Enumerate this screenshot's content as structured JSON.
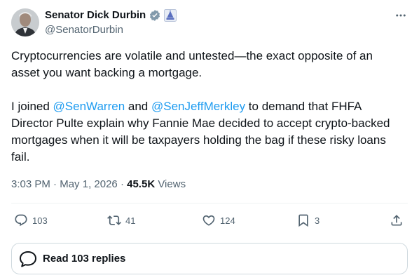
{
  "author": {
    "display_name": "Senator Dick Durbin",
    "handle": "@SenatorDurbin",
    "verified_badge": "government-verified-icon",
    "affiliation_badge": "capitol-icon"
  },
  "tweet": {
    "paragraph1": "Cryptocurrencies are volatile and untested—the exact opposite of an asset you want backing a mortgage.",
    "p2_before": "I joined ",
    "mention1": "@SenWarren",
    "p2_mid": " and ",
    "mention2": "@SenJeffMerkley",
    "p2_after": " to demand that FHFA Director Pulte explain why Fannie Mae decided to accept crypto-backed mortgages when it will be taxpayers holding the bag if these risky loans fail."
  },
  "meta": {
    "time": "3:03 PM",
    "separator": " · ",
    "date": "May 1, 2026",
    "separator2": " · ",
    "views_count": "45.5K",
    "views_label": " Views"
  },
  "actions": {
    "replies": "103",
    "reposts": "41",
    "likes": "124",
    "bookmarks": "3"
  },
  "read_replies": {
    "label": "Read 103 replies"
  },
  "colors": {
    "accent": "#1d9bf0",
    "text": "#0f1419",
    "muted": "#536471",
    "border": "#cfd9de"
  }
}
